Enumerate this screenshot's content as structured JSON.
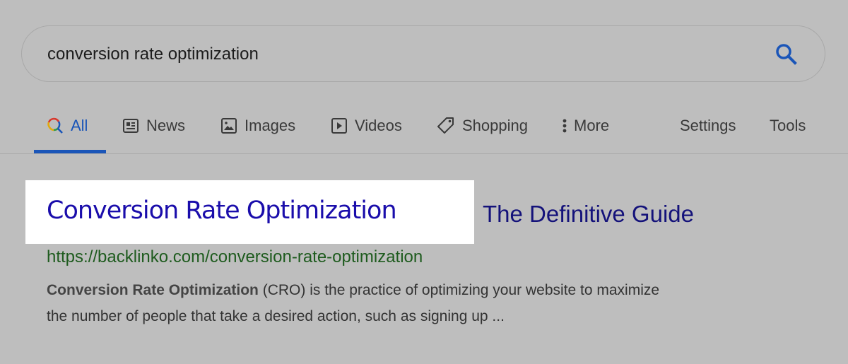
{
  "search": {
    "query": "conversion rate optimization",
    "search_icon": "search-icon",
    "icon_color": "#1a55b8"
  },
  "tabs": {
    "items": [
      {
        "label": "All",
        "icon": "google-search-icon",
        "active": true
      },
      {
        "label": "News",
        "icon": "newspaper-icon"
      },
      {
        "label": "Images",
        "icon": "image-icon"
      },
      {
        "label": "Videos",
        "icon": "play-icon"
      },
      {
        "label": "Shopping",
        "icon": "tag-icon"
      },
      {
        "label": "More",
        "icon": "more-vertical-icon"
      }
    ],
    "settings_label": "Settings",
    "tools_label": "Tools",
    "active_color": "#1a55b8"
  },
  "result": {
    "title_highlighted": "Conversion Rate Optimization",
    "title_rest": "The Definitive Guide",
    "url": "https://backlinko.com/conversion-rate-optimization",
    "snippet_bold": "Conversion Rate Optimization",
    "snippet_line1_rest": " (CRO) is the practice of optimizing your website to maximize",
    "snippet_line2": "the number of people that take a desired action, such as signing up ...",
    "title_color": "#1a0dab",
    "url_color": "#1e5b1e"
  }
}
